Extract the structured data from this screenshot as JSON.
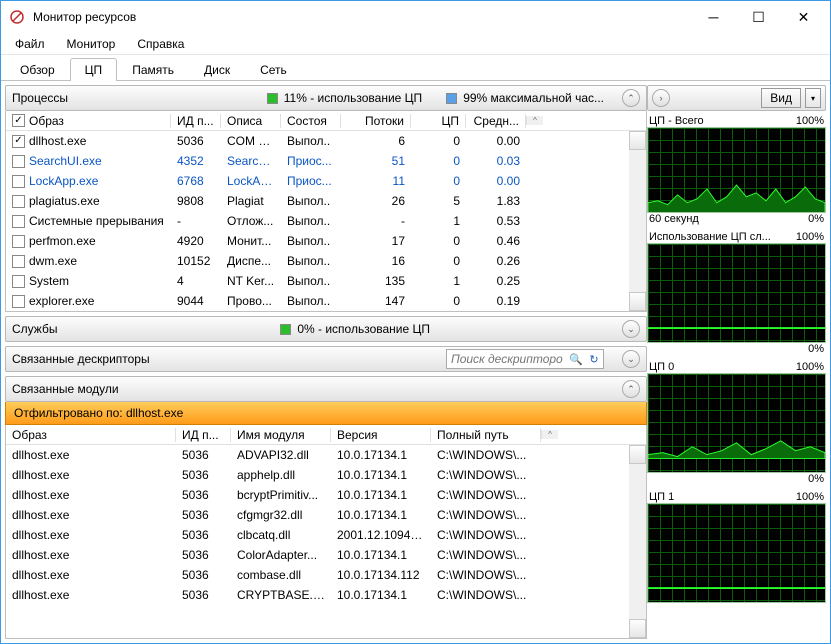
{
  "title": "Монитор ресурсов",
  "menu": [
    "Файл",
    "Монитор",
    "Справка"
  ],
  "tabs": [
    "Обзор",
    "ЦП",
    "Память",
    "Диск",
    "Сеть"
  ],
  "activeTab": 1,
  "sections": {
    "processes": {
      "label": "Процессы",
      "stat1": "11% - использование ЦП",
      "stat2": "99% максимальной час...",
      "columns": [
        "Образ",
        "ИД п...",
        "Описа",
        "Состоя",
        "Потоки",
        "ЦП",
        "Средн..."
      ],
      "rows": [
        {
          "chk": true,
          "name": "dllhost.exe",
          "pid": "5036",
          "desc": "COM S...",
          "state": "Выпол..",
          "threads": "6",
          "cpu": "0",
          "avg": "0.00",
          "suspended": false
        },
        {
          "chk": false,
          "name": "SearchUI.exe",
          "pid": "4352",
          "desc": "Search ...",
          "state": "Приос...",
          "threads": "51",
          "cpu": "0",
          "avg": "0.03",
          "suspended": true
        },
        {
          "chk": false,
          "name": "LockApp.exe",
          "pid": "6768",
          "desc": "LockAp...",
          "state": "Приос...",
          "threads": "11",
          "cpu": "0",
          "avg": "0.00",
          "suspended": true
        },
        {
          "chk": false,
          "name": "plagiatus.exe",
          "pid": "9808",
          "desc": "Plagiat",
          "state": "Выпол..",
          "threads": "26",
          "cpu": "5",
          "avg": "1.83",
          "suspended": false
        },
        {
          "chk": false,
          "name": "Системные прерывания",
          "pid": "-",
          "desc": "Отлож...",
          "state": "Выпол..",
          "threads": "-",
          "cpu": "1",
          "avg": "0.53",
          "suspended": false
        },
        {
          "chk": false,
          "name": "perfmon.exe",
          "pid": "4920",
          "desc": "Монит...",
          "state": "Выпол..",
          "threads": "17",
          "cpu": "0",
          "avg": "0.46",
          "suspended": false
        },
        {
          "chk": false,
          "name": "dwm.exe",
          "pid": "10152",
          "desc": "Диспе...",
          "state": "Выпол..",
          "threads": "16",
          "cpu": "0",
          "avg": "0.26",
          "suspended": false
        },
        {
          "chk": false,
          "name": "System",
          "pid": "4",
          "desc": "NT Ker...",
          "state": "Выпол..",
          "threads": "135",
          "cpu": "1",
          "avg": "0.25",
          "suspended": false
        },
        {
          "chk": false,
          "name": "explorer.exe",
          "pid": "9044",
          "desc": "Прово...",
          "state": "Выпол..",
          "threads": "147",
          "cpu": "0",
          "avg": "0.19",
          "suspended": false
        }
      ]
    },
    "services": {
      "label": "Службы",
      "stat": "0% - использование ЦП"
    },
    "handles": {
      "label": "Связанные дескрипторы",
      "searchPlaceholder": "Поиск дескрипторов"
    },
    "modules": {
      "label": "Связанные модули",
      "filter": "Отфильтровано по: dllhost.exe",
      "columns": [
        "Образ",
        "ИД п...",
        "Имя модуля",
        "Версия",
        "Полный путь"
      ],
      "rows": [
        {
          "name": "dllhost.exe",
          "pid": "5036",
          "mod": "ADVAPI32.dll",
          "ver": "10.0.17134.1",
          "path": "C:\\WINDOWS\\..."
        },
        {
          "name": "dllhost.exe",
          "pid": "5036",
          "mod": "apphelp.dll",
          "ver": "10.0.17134.1",
          "path": "C:\\WINDOWS\\..."
        },
        {
          "name": "dllhost.exe",
          "pid": "5036",
          "mod": "bcryptPrimitiv...",
          "ver": "10.0.17134.1",
          "path": "C:\\WINDOWS\\..."
        },
        {
          "name": "dllhost.exe",
          "pid": "5036",
          "mod": "cfgmgr32.dll",
          "ver": "10.0.17134.1",
          "path": "C:\\WINDOWS\\..."
        },
        {
          "name": "dllhost.exe",
          "pid": "5036",
          "mod": "clbcatq.dll",
          "ver": "2001.12.10941...",
          "path": "C:\\WINDOWS\\..."
        },
        {
          "name": "dllhost.exe",
          "pid": "5036",
          "mod": "ColorAdapter...",
          "ver": "10.0.17134.1",
          "path": "C:\\WINDOWS\\..."
        },
        {
          "name": "dllhost.exe",
          "pid": "5036",
          "mod": "combase.dll",
          "ver": "10.0.17134.112",
          "path": "C:\\WINDOWS\\..."
        },
        {
          "name": "dllhost.exe",
          "pid": "5036",
          "mod": "CRYPTBASE.DLL",
          "ver": "10.0.17134.1",
          "path": "C:\\WINDOWS\\..."
        }
      ]
    }
  },
  "sidebar": {
    "viewLabel": "Вид",
    "graphs": [
      {
        "title": "ЦП - Всего",
        "pct": "100%",
        "footerL": "60 секунд",
        "footerR": "0%",
        "wave": "high"
      },
      {
        "title": "Использование ЦП сл...",
        "pct": "100%",
        "footerL": "",
        "footerR": "0%",
        "wave": "flat"
      },
      {
        "title": "ЦП 0",
        "pct": "100%",
        "footerL": "",
        "footerR": "0%",
        "wave": "med"
      },
      {
        "title": "ЦП 1",
        "pct": "100%",
        "footerL": "",
        "footerR": "",
        "wave": "flat"
      }
    ]
  }
}
